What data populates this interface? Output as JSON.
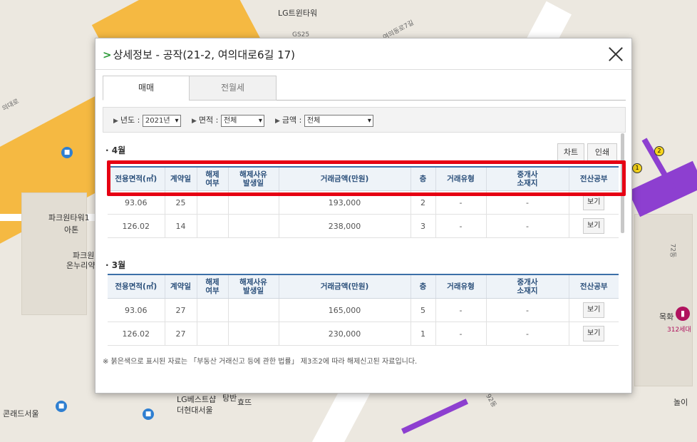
{
  "map": {
    "labels": {
      "lg_twin": "LG트윈타워",
      "gs25": "GS25",
      "road_top": "여의동로7길",
      "road_left": "의대로",
      "park_tower": "파크원타워1",
      "atone": "아톤",
      "park_one": "파크원",
      "onnuri": "온누리약",
      "conrad": "콘래드서울",
      "lg_bestshop": "LG베스트샵",
      "the_hyundai": "더현대서울",
      "tangban": "탕반",
      "hyopyo": "효뜨",
      "mokhwa": "목화",
      "units": "312세대",
      "nolhi": "놀이",
      "num_72": "72동",
      "num_92": "92동"
    },
    "badges": {
      "b1": "1",
      "b2": "2",
      "marker": "▮"
    }
  },
  "modal": {
    "arrow": ">",
    "title": "상세정보 - 공작(21-2, 여의대로6길 17)",
    "tabs": {
      "sale": "매매",
      "rent": "전월세"
    },
    "filters": {
      "year_label": "년도 :",
      "year_value": "2021년",
      "area_label": "면적 :",
      "area_value": "전체",
      "price_label": "금액 :",
      "price_value": "전체"
    },
    "buttons": {
      "chart": "차트",
      "print": "인쇄"
    },
    "columns": {
      "area": "전용면적(㎡)",
      "day": "계약일",
      "cancel1": "해제",
      "cancel2": "여부",
      "reason1": "해제사유",
      "reason2": "발생일",
      "price": "거래금액(만원)",
      "floor": "층",
      "type": "거래유형",
      "agent1": "중개사",
      "agent2": "소재지",
      "registry": "전산공부"
    },
    "months": [
      {
        "label": "· 4월",
        "rows": [
          {
            "area": "93.06",
            "day": "25",
            "cancel": "",
            "reason": "",
            "price": "193,000",
            "floor": "2",
            "type": "-",
            "agent": "-",
            "view": "보기"
          },
          {
            "area": "126.02",
            "day": "14",
            "cancel": "",
            "reason": "",
            "price": "238,000",
            "floor": "3",
            "type": "-",
            "agent": "-",
            "view": "보기"
          }
        ]
      },
      {
        "label": "· 3월",
        "rows": [
          {
            "area": "93.06",
            "day": "27",
            "cancel": "",
            "reason": "",
            "price": "165,000",
            "floor": "5",
            "type": "-",
            "agent": "-",
            "view": "보기"
          },
          {
            "area": "126.02",
            "day": "27",
            "cancel": "",
            "reason": "",
            "price": "230,000",
            "floor": "1",
            "type": "-",
            "agent": "-",
            "view": "보기"
          }
        ]
      }
    ],
    "footnote": "※ 붉은색으로 표시된 자료는 「부동산 거래신고 등에 관한 법률」 제3조2에 따라 해제신고된 자료입니다."
  }
}
